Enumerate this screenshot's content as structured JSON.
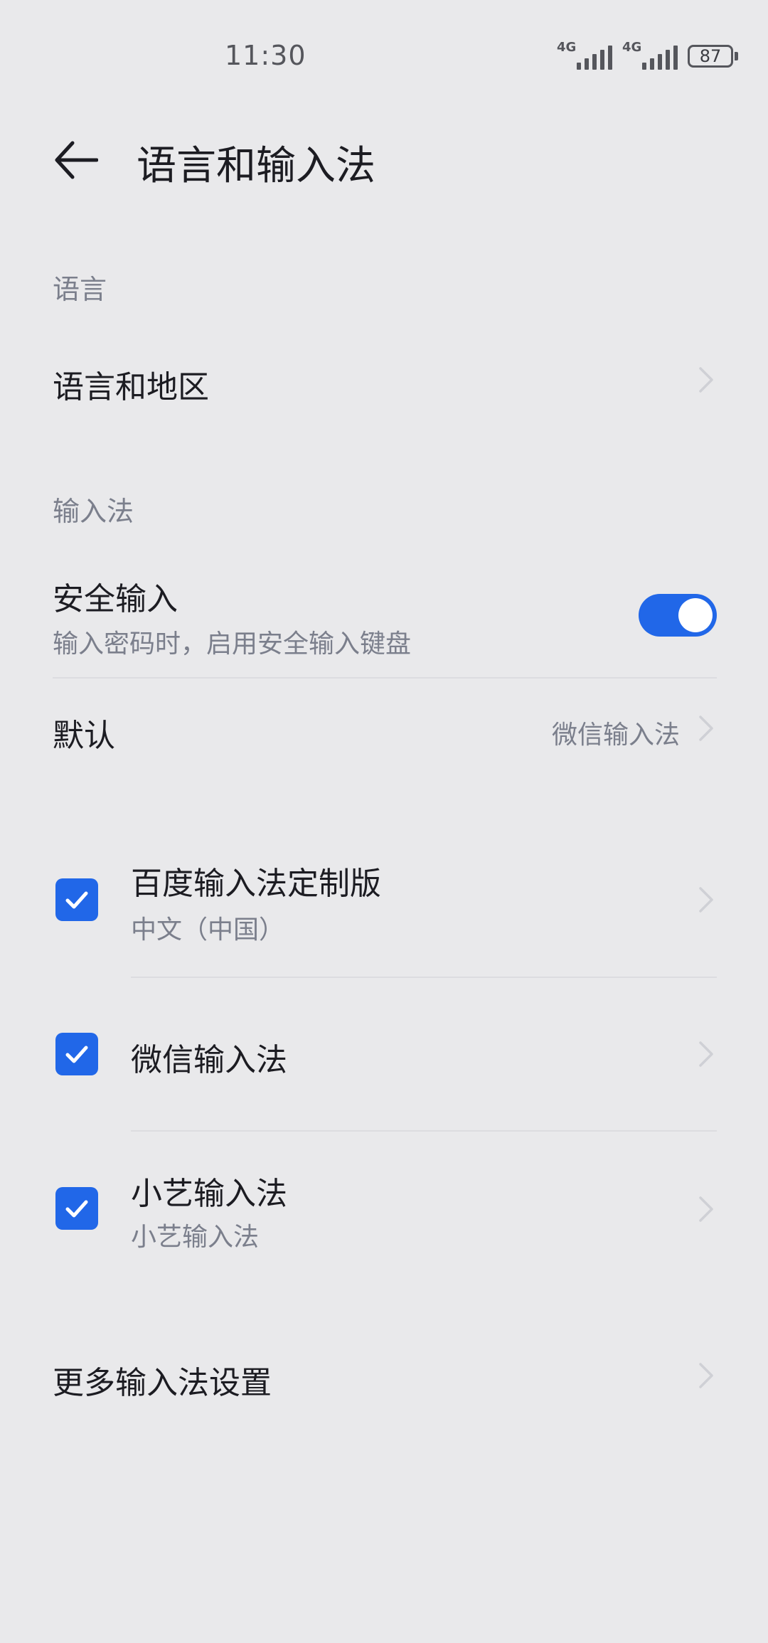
{
  "status_bar": {
    "time": "11:30",
    "signal_label_1": "4G",
    "signal_label_2": "4G",
    "battery": "87",
    "icons": [
      "signal-icon",
      "signal-icon",
      "battery-icon"
    ]
  },
  "header": {
    "title": "语言和输入法",
    "back_icon": "back-arrow-icon"
  },
  "language_section": {
    "label": "语言",
    "items": [
      {
        "title": "语言和地区"
      }
    ]
  },
  "input_section": {
    "label": "输入法",
    "secure_input": {
      "title": "安全输入",
      "subtitle": "输入密码时，启用安全输入键盘",
      "enabled": true
    },
    "default": {
      "title": "默认",
      "value": "微信输入法"
    },
    "keyboards": [
      {
        "title": "百度输入法定制版",
        "subtitle": "中文（中国）",
        "checked": true
      },
      {
        "title": "微信输入法",
        "subtitle": "",
        "checked": true
      },
      {
        "title": "小艺输入法",
        "subtitle": "小艺输入法",
        "checked": true
      }
    ],
    "more": {
      "title": "更多输入法设置"
    }
  },
  "colors": {
    "accent": "#2167e8",
    "background": "#e9e9eb",
    "primary_text": "#1c1c22",
    "secondary_text": "#7b7f8c"
  }
}
